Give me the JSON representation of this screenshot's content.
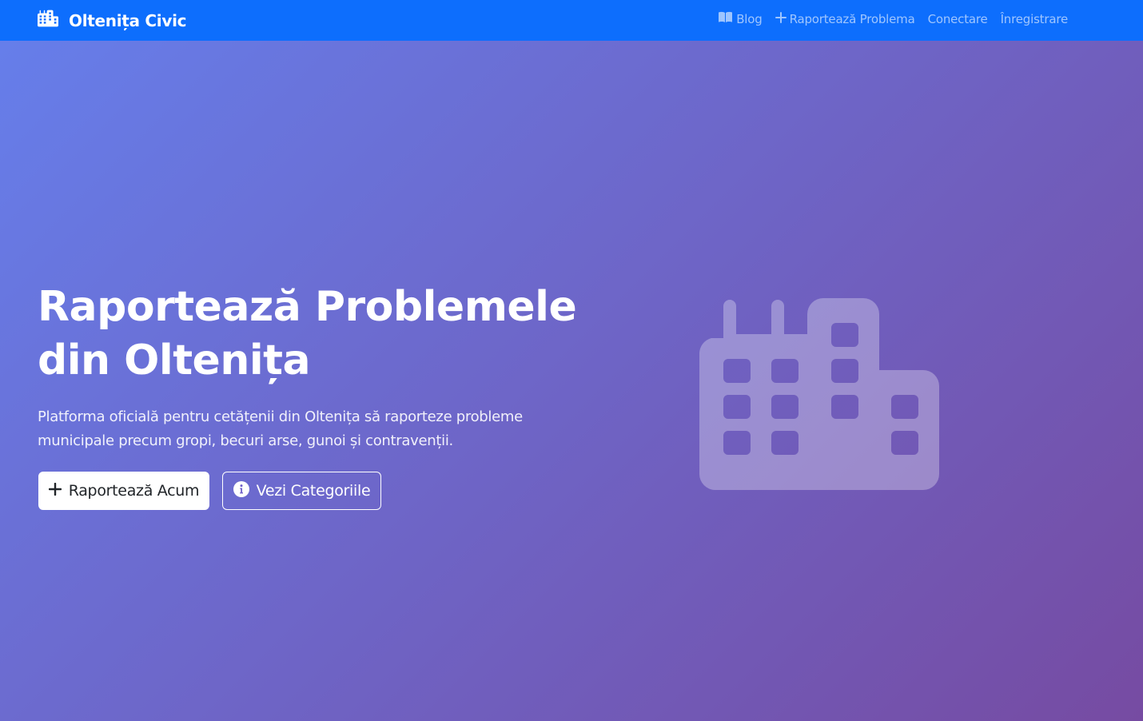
{
  "navbar": {
    "brand": "Oltenița Civic",
    "links": [
      {
        "label": "Blog",
        "icon": "book-icon"
      },
      {
        "label": "Raportează Problema",
        "icon": "plus-icon"
      },
      {
        "label": "Conectare"
      },
      {
        "label": "Înregistrare"
      }
    ]
  },
  "hero": {
    "title_line1": "Raportează Problemele",
    "title_line2": "din Oltenița",
    "description": "Platforma oficială pentru cetățenii din Oltenița să raporteze probleme municipale precum gropi, becuri arse, gunoi și contravenții.",
    "primary_button": "Raportează Acum",
    "secondary_button": "Vezi Categoriile",
    "graphic": "building-icon"
  },
  "colors": {
    "navbar": "#0d6efd",
    "gradient_start": "#667eea",
    "gradient_end": "#764ba2"
  }
}
